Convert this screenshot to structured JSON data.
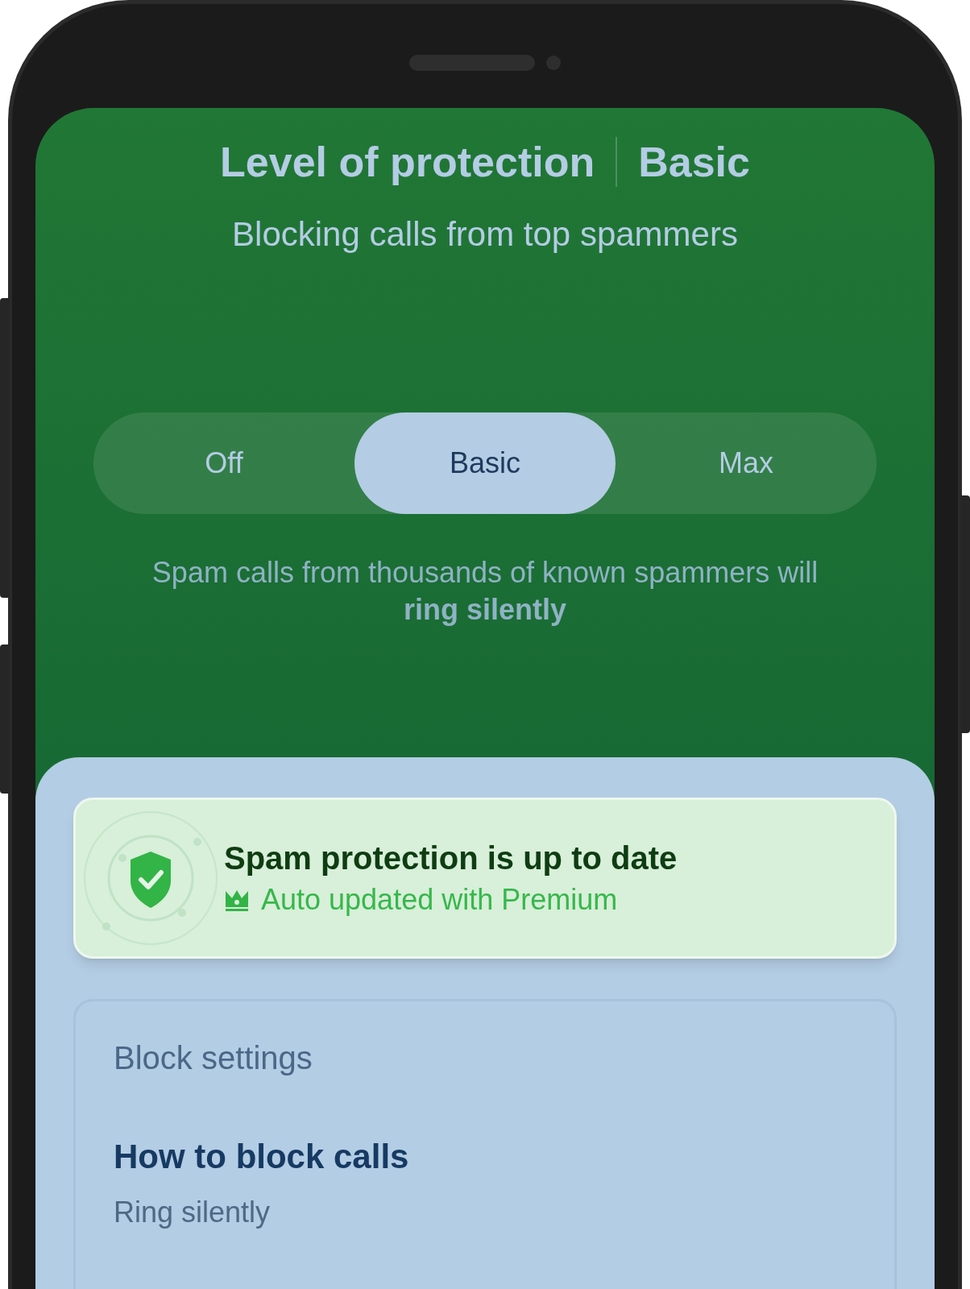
{
  "header": {
    "title": "Level of protection",
    "level": "Basic",
    "subtitle": "Blocking calls from top spammers"
  },
  "levels": [
    {
      "label": "Off",
      "selected": false
    },
    {
      "label": "Basic",
      "selected": true
    },
    {
      "label": "Max",
      "selected": false
    }
  ],
  "level_description": "Spam calls from thousands of known spammers will **ring silently**",
  "status_card": {
    "title": "Spam protection is up to date",
    "subtitle": "Auto updated with Premium"
  },
  "block_settings": {
    "title": "Block settings",
    "items": [
      {
        "title": "How to block calls",
        "value": "Ring silently"
      }
    ]
  }
}
